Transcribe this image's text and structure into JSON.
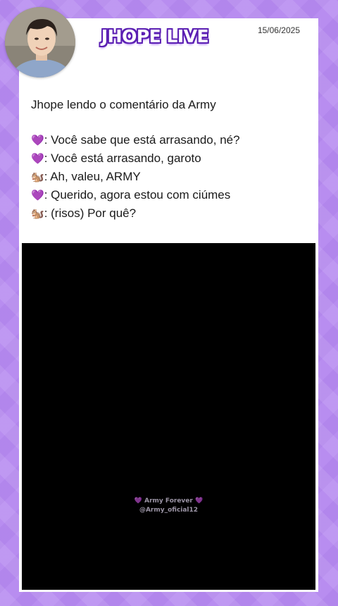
{
  "header": {
    "title": "JHOPE LIVE",
    "date": "15/06/2025",
    "avatar_icon": "profile-photo"
  },
  "post": {
    "intro": "Jhope lendo o comentário da Army",
    "lines": [
      {
        "icon": "💜",
        "icon_name": "purple-heart-icon",
        "text": ": Você sabe que está arrasando, né?"
      },
      {
        "icon": "💜",
        "icon_name": "purple-heart-icon",
        "text": ": Você está arrasando, garoto"
      },
      {
        "icon": "🐿️",
        "icon_name": "squirrel-icon",
        "text": ": Ah, valeu, ARMY"
      },
      {
        "icon": "💜",
        "icon_name": "purple-heart-icon",
        "text": ": Querido, agora estou com ciúmes"
      },
      {
        "icon": "🐿️",
        "icon_name": "squirrel-icon",
        "text": ": (risos) Por quê?"
      }
    ]
  },
  "video": {
    "watermark_line1": "Army Forever",
    "watermark_heart": "💜",
    "watermark_line2": "@Army_oficial12"
  },
  "colors": {
    "background": "#b88df0",
    "title_outline": "#5b1fb3",
    "accent_heart": "#8e44ad"
  }
}
